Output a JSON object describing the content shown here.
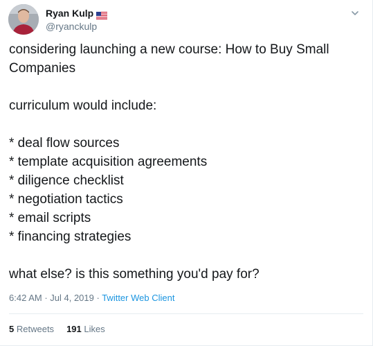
{
  "author": {
    "display_name": "Ryan Kulp",
    "handle": "@ryanckulp"
  },
  "tweet": {
    "lines": [
      "considering launching a new course: How to Buy Small",
      "Companies",
      "",
      "curriculum would include:",
      "",
      "* deal flow sources",
      "* template acquisition agreements",
      "* diligence checklist",
      "* negotiation tactics",
      "* email scripts",
      "* financing strategies",
      "",
      "what else? is this something you'd pay for?"
    ]
  },
  "meta": {
    "time": "6:42 AM",
    "sep1": " · ",
    "date": "Jul 4, 2019",
    "sep2": " · ",
    "client": "Twitter Web Client"
  },
  "stats": {
    "retweets_count": "5",
    "retweets_label": "Retweets",
    "likes_count": "191",
    "likes_label": "Likes"
  },
  "icons": {
    "flag": "us-flag-icon",
    "menu": "chevron-down-icon"
  },
  "colors": {
    "link": "#1b95e0",
    "secondary_text": "#657786",
    "border": "#e6ecf0"
  }
}
